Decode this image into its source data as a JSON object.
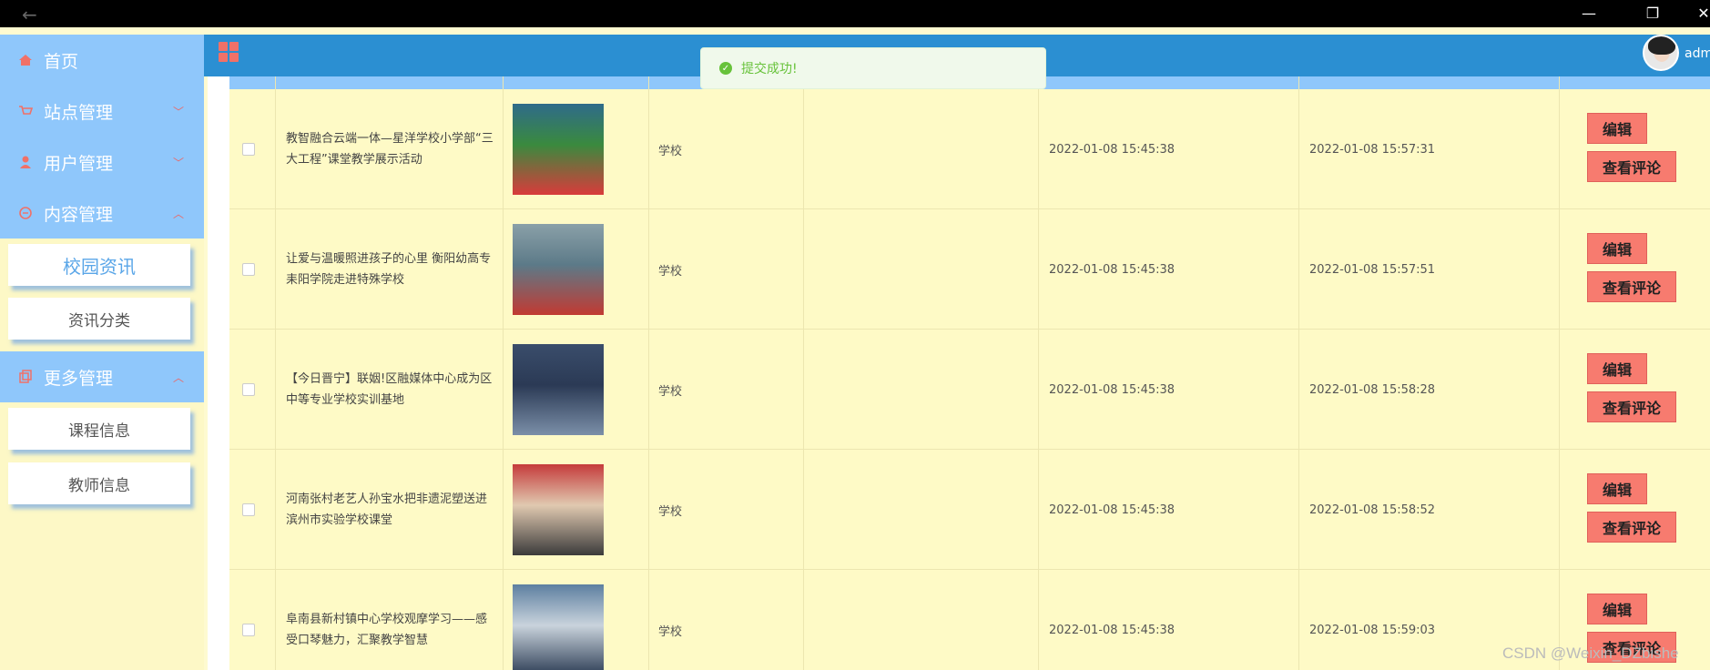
{
  "sidebar": {
    "items": [
      {
        "label": "首页",
        "icon": "home-icon",
        "expanded": null
      },
      {
        "label": "站点管理",
        "icon": "cart-icon",
        "expanded": false
      },
      {
        "label": "用户管理",
        "icon": "user-icon",
        "expanded": false
      },
      {
        "label": "内容管理",
        "icon": "chat-icon",
        "expanded": true,
        "children": [
          {
            "label": "校园资讯",
            "active": true
          },
          {
            "label": "资讯分类",
            "active": false
          }
        ]
      },
      {
        "label": "更多管理",
        "icon": "copy-icon",
        "expanded": true,
        "children": [
          {
            "label": "课程信息",
            "active": false
          },
          {
            "label": "教师信息",
            "active": false
          }
        ]
      }
    ]
  },
  "header": {
    "username": "admi"
  },
  "toast": {
    "message": "提交成功!"
  },
  "table": {
    "rows": [
      {
        "title": "教智融合云端一体—星洋学校小学部“三大工程”课堂教学展示活动",
        "type": "学校",
        "blank": "",
        "created": "2022-01-08 15:45:38",
        "updated": "2022-01-08 15:57:31"
      },
      {
        "title": "让爱与温暖照进孩子的心里 衡阳幼高专耒阳学院走进特殊学校",
        "type": "学校",
        "blank": "",
        "created": "2022-01-08 15:45:38",
        "updated": "2022-01-08 15:57:51"
      },
      {
        "title": "【今日晋宁】联姻!区融媒体中心成为区中等专业学校实训基地",
        "type": "学校",
        "blank": "",
        "created": "2022-01-08 15:45:38",
        "updated": "2022-01-08 15:58:28"
      },
      {
        "title": "河南张村老艺人孙宝水把非遗泥塑送进滨州市实验学校课堂",
        "type": "学校",
        "blank": "",
        "created": "2022-01-08 15:45:38",
        "updated": "2022-01-08 15:58:52"
      },
      {
        "title": "阜南县新村镇中心学校观摩学习——感受口琴魅力，汇聚教学智慧",
        "type": "学校",
        "blank": "",
        "created": "2022-01-08 15:45:38",
        "updated": "2022-01-08 15:59:03"
      }
    ],
    "edit_label": "编辑",
    "comments_label": "查看评论"
  },
  "watermark": "CSDN @Weixin_DZbishe",
  "colors": {
    "menu": "#8fc7fb",
    "header": "#2b8fd2",
    "button": "#f77b6f",
    "row": "#fefac6"
  }
}
